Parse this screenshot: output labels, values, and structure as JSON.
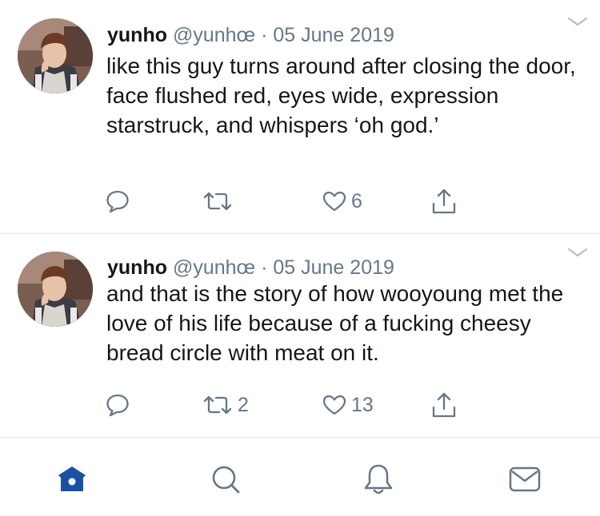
{
  "tweets": [
    {
      "name": "yunho",
      "handle": "@yunhœ",
      "separator": "·",
      "date": "05 June 2019",
      "text": "like this guy turns around after closing the door, face flushed red, eyes wide, expression starstruck, and whispers ‘oh god.’",
      "retweets": "",
      "likes": "6"
    },
    {
      "name": "yunho",
      "handle": "@yunhœ",
      "separator": "·",
      "date": "05 June 2019",
      "text": "and that is the story of how wooyoung met the love of his life because of a fucking cheesy bread circle with meat on it.",
      "retweets": "2",
      "likes": "13"
    }
  ],
  "icons": {
    "reply": "reply-icon",
    "retweet": "retweet-icon",
    "like": "heart-icon",
    "share": "share-icon",
    "more": "chevron-down-icon"
  },
  "tabbar": {
    "tabs": [
      {
        "id": "home",
        "icon": "home-icon",
        "active": true
      },
      {
        "id": "search",
        "icon": "search-icon",
        "active": false
      },
      {
        "id": "notifications",
        "icon": "bell-icon",
        "active": false
      },
      {
        "id": "messages",
        "icon": "mail-icon",
        "active": false
      }
    ]
  },
  "colors": {
    "accent": "#1d4fa3",
    "icon_gray": "#657786",
    "text": "#14171a",
    "divider": "#e1e8ed"
  }
}
